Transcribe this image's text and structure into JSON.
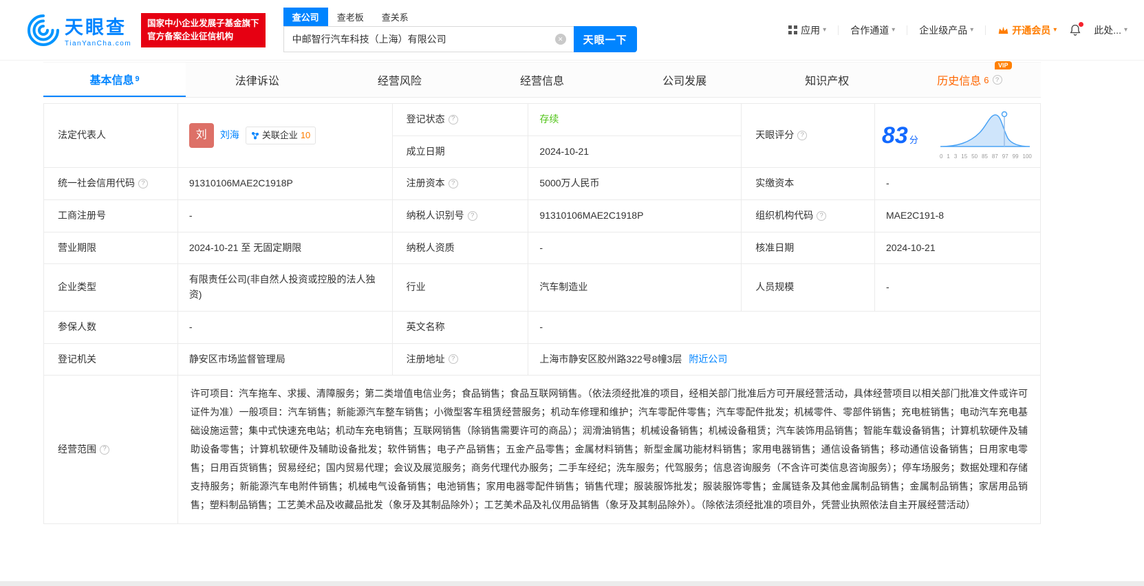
{
  "colors": {
    "brand_blue": "#0084ff",
    "badge_red": "#e60012",
    "member_orange": "#ff7d00",
    "history_orange": "#ff6600",
    "status_green": "#52c41a",
    "score_blue": "#1269ff"
  },
  "icons": {
    "caret": "▾",
    "clear": "✕",
    "question": "?",
    "vip": "VIP"
  },
  "header": {
    "logo": {
      "brand": "天眼查",
      "domain": "TianYanCha.com"
    },
    "badge": {
      "line1": "国家中小企业发展子基金旗下",
      "line2": "官方备案企业征信机构"
    },
    "search_tabs": [
      {
        "label": "查公司",
        "active": true
      },
      {
        "label": "查老板",
        "active": false
      },
      {
        "label": "查关系",
        "active": false
      }
    ],
    "search": {
      "value": "中邮智行汽车科技（上海）有限公司",
      "button": "天眼一下"
    },
    "nav": {
      "apps": "应用",
      "partner": "合作通道",
      "enterprise": "企业级产品",
      "member": "开通会员",
      "more": "此处..."
    }
  },
  "tabs": [
    {
      "label": "基本信息",
      "count": "9",
      "active": true
    },
    {
      "label": "法律诉讼"
    },
    {
      "label": "经营风险"
    },
    {
      "label": "经营信息"
    },
    {
      "label": "公司发展"
    },
    {
      "label": "知识产权"
    },
    {
      "label": "历史信息",
      "count": "6",
      "vip": true
    }
  ],
  "info": {
    "legal_rep": {
      "label": "法定代表人",
      "avatar": "刘",
      "name": "刘海",
      "related_label": "关联企业",
      "related_count": "10"
    },
    "reg_status": {
      "label": "登记状态",
      "value": "存续"
    },
    "est_date": {
      "label": "成立日期",
      "value": "2024-10-21"
    },
    "score": {
      "label": "天眼评分",
      "value": "83",
      "unit": "分"
    },
    "credit_code": {
      "label": "统一社会信用代码",
      "value": "91310106MAE2C1918P"
    },
    "reg_capital": {
      "label": "注册资本",
      "value": "5000万人民币"
    },
    "paid_capital": {
      "label": "实缴资本",
      "value": "-"
    },
    "biz_reg_no": {
      "label": "工商注册号",
      "value": "-"
    },
    "taxpayer_id": {
      "label": "纳税人识别号",
      "value": "91310106MAE2C1918P"
    },
    "org_code": {
      "label": "组织机构代码",
      "value": "MAE2C191-8"
    },
    "biz_term": {
      "label": "营业期限",
      "value": "2024-10-21 至 无固定期限"
    },
    "taxpayer_qual": {
      "label": "纳税人资质",
      "value": "-"
    },
    "approval_date": {
      "label": "核准日期",
      "value": "2024-10-21"
    },
    "company_type": {
      "label": "企业类型",
      "value": "有限责任公司(非自然人投资或控股的法人独资)"
    },
    "industry": {
      "label": "行业",
      "value": "汽车制造业"
    },
    "staff_size": {
      "label": "人员规模",
      "value": "-"
    },
    "insured_count": {
      "label": "参保人数",
      "value": "-"
    },
    "english_name": {
      "label": "英文名称",
      "value": "-"
    },
    "reg_authority": {
      "label": "登记机关",
      "value": "静安区市场监督管理局"
    },
    "reg_address": {
      "label": "注册地址",
      "value": "上海市静安区胶州路322号8幢3层",
      "nearby": "附近公司"
    },
    "business_scope": {
      "label": "经营范围",
      "value": "许可项目：汽车拖车、求援、清障服务；第二类增值电信业务；食品销售；食品互联网销售。（依法须经批准的项目，经相关部门批准后方可开展经营活动，具体经营项目以相关部门批准文件或许可证件为准）一般项目：汽车销售；新能源汽车整车销售；小微型客车租赁经营服务；机动车修理和维护；汽车零配件零售；汽车零配件批发；机械零件、零部件销售；充电桩销售；电动汽车充电基础设施运营；集中式快速充电站；机动车充电销售；互联网销售（除销售需要许可的商品）；润滑油销售；机械设备销售；机械设备租赁；汽车装饰用品销售；智能车载设备销售；计算机软硬件及辅助设备零售；计算机软硬件及辅助设备批发；软件销售；电子产品销售；五金产品零售；金属材料销售；新型金属功能材料销售；家用电器销售；通信设备销售；移动通信设备销售；日用家电零售；日用百货销售；贸易经纪；国内贸易代理；会议及展览服务；商务代理代办服务；二手车经纪；洗车服务；代驾服务；信息咨询服务（不含许可类信息咨询服务）；停车场服务；数据处理和存储支持服务；新能源汽车电附件销售；机械电气设备销售；电池销售；家用电器零配件销售；销售代理；服装服饰批发；服装服饰零售；金属链条及其他金属制品销售；金属制品销售；家居用品销售；塑料制品销售；工艺美术品及收藏品批发（象牙及其制品除外）；工艺美术品及礼仪用品销售（象牙及其制品除外）。（除依法须经批准的项目外，凭营业执照依法自主开展经营活动）"
    }
  },
  "score_chart": {
    "type": "area",
    "x_labels": [
      "0",
      "1",
      "3",
      "15",
      "50",
      "85",
      "87",
      "97",
      "99",
      "100"
    ],
    "score": "83"
  }
}
